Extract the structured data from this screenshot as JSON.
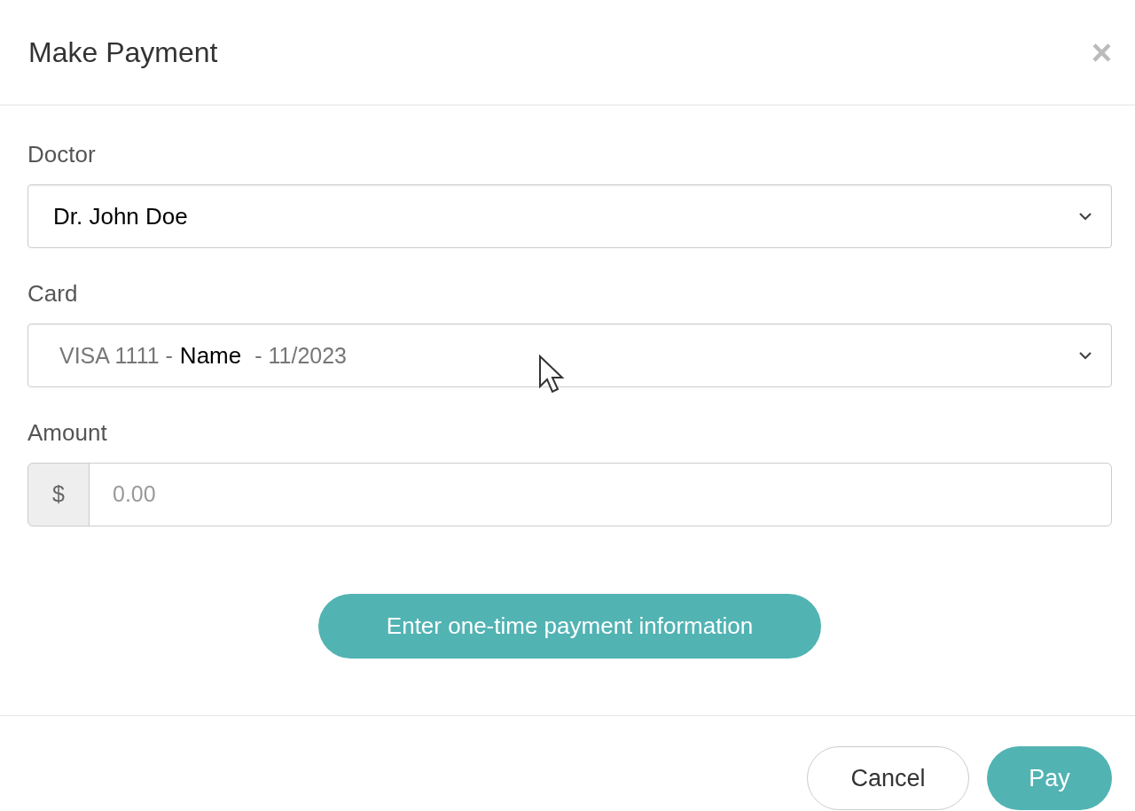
{
  "modal": {
    "title": "Make Payment",
    "close": "×"
  },
  "fields": [
    {
      "kind": "select",
      "label": "Doctor",
      "parts": [
        {
          "text": "Dr. John Doe",
          "muted": false
        }
      ]
    },
    {
      "kind": "select",
      "label": "Card",
      "parts": [
        {
          "text": "VISA 1111 -",
          "muted": true
        },
        {
          "text": "Name",
          "muted": false
        },
        {
          "text": "- 11/2023",
          "muted": true
        }
      ]
    },
    {
      "kind": "money",
      "label": "Amount",
      "prefix": "$",
      "placeholder": "0.00"
    }
  ],
  "one_time_button": "Enter one-time payment information",
  "footer_buttons": [
    {
      "label": "Cancel",
      "kind": "secondary"
    },
    {
      "label": "Pay",
      "kind": "primary"
    }
  ]
}
